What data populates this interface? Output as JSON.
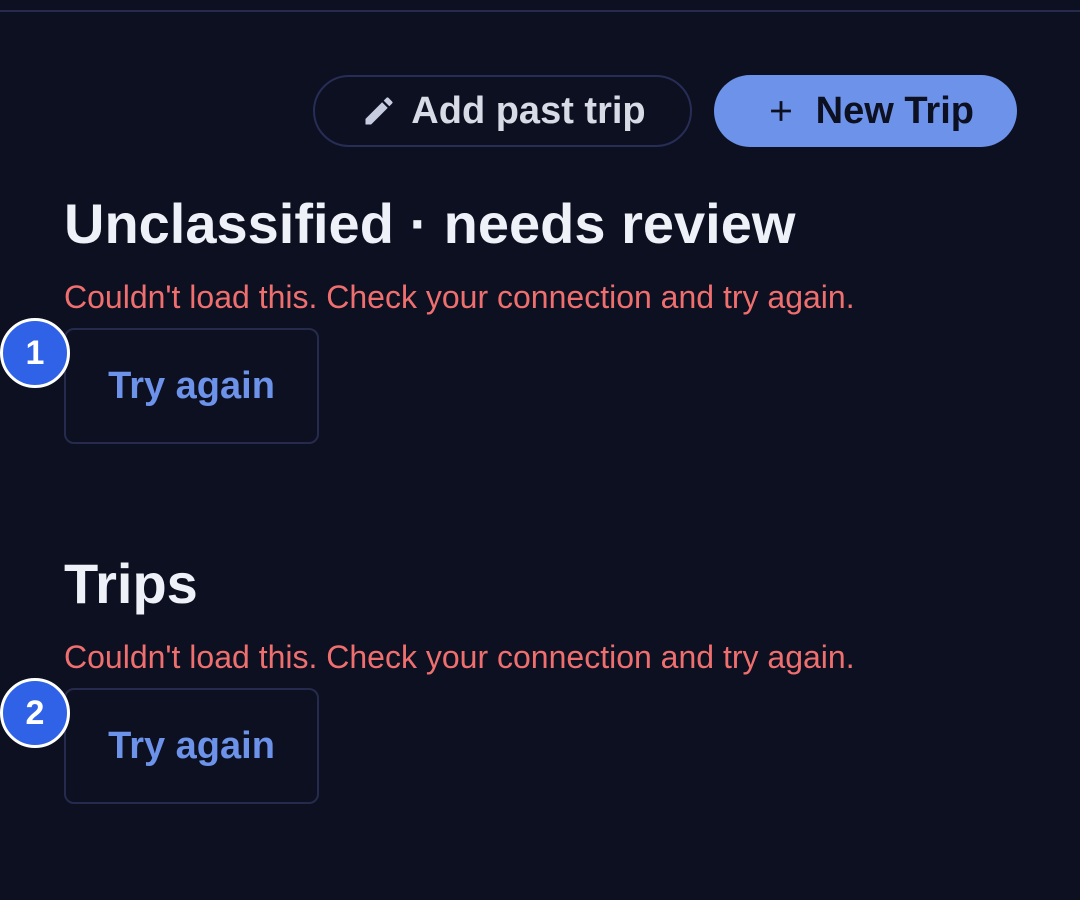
{
  "toolbar": {
    "add_past_trip": {
      "label": "Add past trip",
      "icon": "pencil-icon"
    },
    "new_trip": {
      "label": "New Trip",
      "icon": "plus-icon"
    }
  },
  "sections": [
    {
      "title": "Unclassified · needs review",
      "error": "Couldn't load this. Check your connection and try again.",
      "retry_label": "Try again",
      "badge": "1"
    },
    {
      "title": "Trips",
      "error": "Couldn't load this. Check your connection and try again.",
      "retry_label": "Try again",
      "badge": "2"
    }
  ],
  "colors": {
    "background": "#0d1020",
    "accent": "#6c92ea",
    "error": "#ef6f6f",
    "border": "#262b4d",
    "badge": "#2f62e6"
  }
}
